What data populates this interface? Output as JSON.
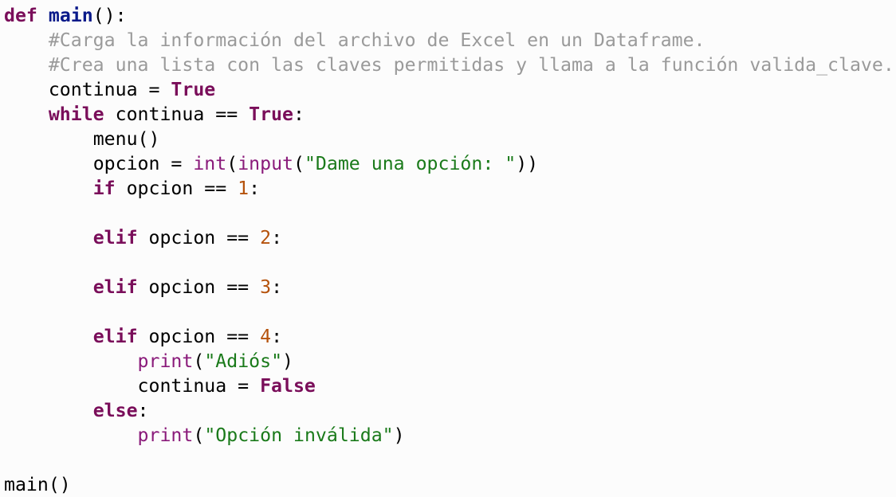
{
  "editor": {
    "language": "python",
    "colors": {
      "background": "#fcfcfc",
      "keyword": "#7a0e5a",
      "function_name": "#0a1a8a",
      "builtin": "#8a1a7a",
      "string": "#1a7a1a",
      "number": "#b5520b",
      "comment": "#9a9a9a",
      "plain": "#000000"
    },
    "lines": [
      {
        "indent": "",
        "tokens": [
          {
            "t": "kw",
            "v": "def"
          },
          {
            "t": "plain",
            "v": " "
          },
          {
            "t": "fn",
            "v": "main"
          },
          {
            "t": "plain",
            "v": "():"
          }
        ]
      },
      {
        "indent": "    ",
        "tokens": [
          {
            "t": "cmt",
            "v": "#Carga la información del archivo de Excel en un Dataframe."
          }
        ]
      },
      {
        "indent": "    ",
        "tokens": [
          {
            "t": "cmt",
            "v": "#Crea una lista con las claves permitidas y llama a la función valida_clave."
          }
        ]
      },
      {
        "indent": "    ",
        "tokens": [
          {
            "t": "plain",
            "v": "continua = "
          },
          {
            "t": "kw",
            "v": "True"
          }
        ]
      },
      {
        "indent": "    ",
        "tokens": [
          {
            "t": "kw",
            "v": "while"
          },
          {
            "t": "plain",
            "v": " continua == "
          },
          {
            "t": "kw",
            "v": "True"
          },
          {
            "t": "plain",
            "v": ":"
          }
        ]
      },
      {
        "indent": "        ",
        "tokens": [
          {
            "t": "plain",
            "v": "menu()"
          }
        ]
      },
      {
        "indent": "        ",
        "tokens": [
          {
            "t": "plain",
            "v": "opcion = "
          },
          {
            "t": "bi",
            "v": "int"
          },
          {
            "t": "plain",
            "v": "("
          },
          {
            "t": "bi",
            "v": "input"
          },
          {
            "t": "plain",
            "v": "("
          },
          {
            "t": "str",
            "v": "\"Dame una opción: \""
          },
          {
            "t": "plain",
            "v": "))"
          }
        ]
      },
      {
        "indent": "        ",
        "tokens": [
          {
            "t": "kw",
            "v": "if"
          },
          {
            "t": "plain",
            "v": " opcion == "
          },
          {
            "t": "num",
            "v": "1"
          },
          {
            "t": "plain",
            "v": ":"
          }
        ]
      },
      {
        "indent": "",
        "tokens": []
      },
      {
        "indent": "        ",
        "tokens": [
          {
            "t": "kw",
            "v": "elif"
          },
          {
            "t": "plain",
            "v": " opcion == "
          },
          {
            "t": "num",
            "v": "2"
          },
          {
            "t": "plain",
            "v": ":"
          }
        ]
      },
      {
        "indent": "",
        "tokens": []
      },
      {
        "indent": "        ",
        "tokens": [
          {
            "t": "kw",
            "v": "elif"
          },
          {
            "t": "plain",
            "v": " opcion == "
          },
          {
            "t": "num",
            "v": "3"
          },
          {
            "t": "plain",
            "v": ":"
          }
        ]
      },
      {
        "indent": "",
        "tokens": []
      },
      {
        "indent": "        ",
        "tokens": [
          {
            "t": "kw",
            "v": "elif"
          },
          {
            "t": "plain",
            "v": " opcion == "
          },
          {
            "t": "num",
            "v": "4"
          },
          {
            "t": "plain",
            "v": ":"
          }
        ]
      },
      {
        "indent": "            ",
        "tokens": [
          {
            "t": "bi",
            "v": "print"
          },
          {
            "t": "plain",
            "v": "("
          },
          {
            "t": "str",
            "v": "\"Adiós\""
          },
          {
            "t": "plain",
            "v": ")"
          }
        ]
      },
      {
        "indent": "            ",
        "tokens": [
          {
            "t": "plain",
            "v": "continua = "
          },
          {
            "t": "kw",
            "v": "False"
          }
        ]
      },
      {
        "indent": "        ",
        "tokens": [
          {
            "t": "kw",
            "v": "else"
          },
          {
            "t": "plain",
            "v": ":"
          }
        ]
      },
      {
        "indent": "            ",
        "tokens": [
          {
            "t": "bi",
            "v": "print"
          },
          {
            "t": "plain",
            "v": "("
          },
          {
            "t": "str",
            "v": "\"Opción inválida\""
          },
          {
            "t": "plain",
            "v": ")"
          }
        ]
      },
      {
        "indent": "",
        "tokens": []
      },
      {
        "indent": "",
        "tokens": [
          {
            "t": "plain",
            "v": "main()"
          }
        ]
      }
    ]
  }
}
